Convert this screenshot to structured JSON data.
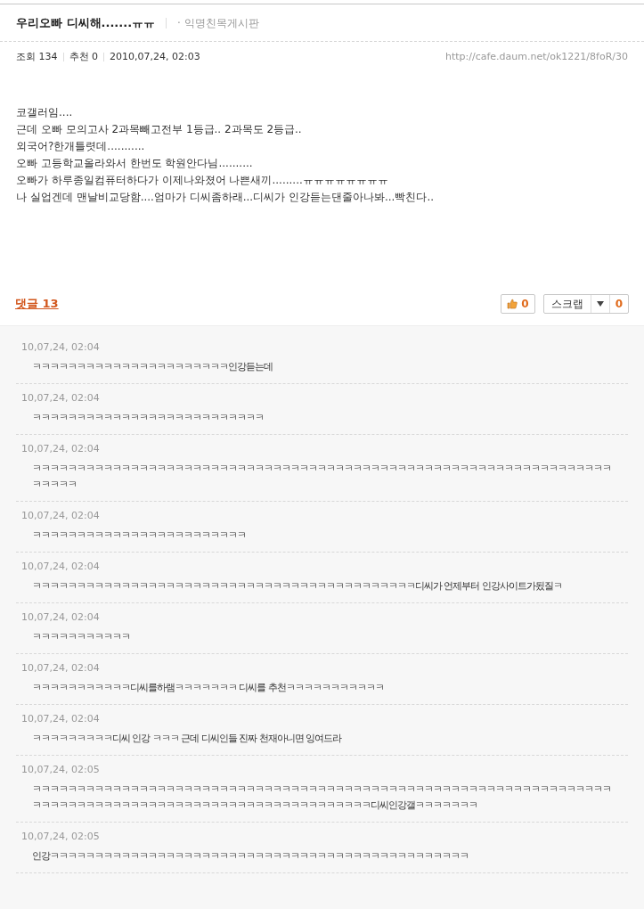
{
  "post": {
    "title": "우리오빠 디씨해.......ㅠㅠ",
    "board": "· 익명친목게시판",
    "meta": [
      "조회 134",
      "추천 0",
      "2010,07,24, 02:03"
    ],
    "url": "http://cafe.daum.net/ok1221/8foR/30",
    "body": [
      "코갤러임....",
      "근데 오빠 모의고사 2과목빼고전부 1등급.. 2과목도 2등급..",
      "외국어?한개틀렷데...........",
      "오빠 고등학교올라와서 한번도 학원안다님..........",
      "오빠가 하루종일컴퓨터하다가 이제나와졌어 나쁜새끼.........ㅠㅠㅠㅠㅠㅠㅠㅠ",
      "나 실업겐데 맨날비교당함....엄마가 디씨좀하래...디씨가 인강듣는댄줄아나봐...빡친다.."
    ]
  },
  "comments_header": {
    "label": "댓글 13",
    "like_count": "0",
    "scrap_label": "스크랩",
    "scrap_count": "0"
  },
  "comments": [
    {
      "time": "10,07,24, 02:04",
      "lines": [
        "ㅋㅋㅋㅋㅋㅋㅋㅋㅋㅋㅋㅋㅋㅋㅋㅋㅋㅋㅋㅋㅋㅋ인강듣는데"
      ]
    },
    {
      "time": "10,07,24, 02:04",
      "lines": [
        "ㅋㅋㅋㅋㅋㅋㅋㅋㅋㅋㅋㅋㅋㅋㅋㅋㅋㅋㅋㅋㅋㅋㅋㅋㅋㅋ"
      ]
    },
    {
      "time": "10,07,24, 02:04",
      "lines": [
        "ㅋㅋㅋㅋㅋㅋㅋㅋㅋㅋㅋㅋㅋㅋㅋㅋㅋㅋㅋㅋㅋㅋㅋㅋㅋㅋㅋㅋㅋㅋㅋㅋㅋㅋㅋㅋㅋㅋㅋㅋㅋㅋㅋㅋㅋㅋㅋㅋㅋㅋㅋㅋㅋㅋㅋㅋㅋㅋㅋㅋㅋㅋㅋㅋㅋ",
        "ㅋㅋㅋㅋㅋ"
      ]
    },
    {
      "time": "10,07,24, 02:04",
      "lines": [
        "ㅋㅋㅋㅋㅋㅋㅋㅋㅋㅋㅋㅋㅋㅋㅋㅋㅋㅋㅋㅋㅋㅋㅋㅋ"
      ]
    },
    {
      "time": "10,07,24, 02:04",
      "lines": [
        "ㅋㅋㅋㅋㅋㅋㅋㅋㅋㅋㅋㅋㅋㅋㅋㅋㅋㅋㅋㅋㅋㅋㅋㅋㅋㅋㅋㅋㅋㅋㅋㅋㅋㅋㅋㅋㅋㅋㅋㅋㅋㅋㅋ디씨가 언제부터 인강사이트가됬질ㅋ"
      ]
    },
    {
      "time": "10,07,24, 02:04",
      "lines": [
        "ㅋㅋㅋㅋㅋㅋㅋㅋㅋㅋㅋ"
      ]
    },
    {
      "time": "10,07,24, 02:04",
      "lines": [
        "ㅋㅋㅋㅋㅋㅋㅋㅋㅋㅋㅋ디씨를하램ㅋㅋㅋㅋㅋㅋㅋ 디씨를 추천ㅋㅋㅋㅋㅋㅋㅋㅋㅋㅋㅋ"
      ]
    },
    {
      "time": "10,07,24, 02:04",
      "lines": [
        "ㅋㅋㅋㅋㅋㅋㅋㅋㅋ디씨 인강 ㅋㅋㅋ 근데 디씨인들 진짜 천재아니면 잉여드라"
      ]
    },
    {
      "time": "10,07,24, 02:05",
      "lines": [
        "ㅋㅋㅋㅋㅋㅋㅋㅋㅋㅋㅋㅋㅋㅋㅋㅋㅋㅋㅋㅋㅋㅋㅋㅋㅋㅋㅋㅋㅋㅋㅋㅋㅋㅋㅋㅋㅋㅋㅋㅋㅋㅋㅋㅋㅋㅋㅋㅋㅋㅋㅋㅋㅋㅋㅋㅋㅋㅋㅋㅋㅋㅋㅋㅋㅋ",
        "ㅋㅋㅋㅋㅋㅋㅋㅋㅋㅋㅋㅋㅋㅋㅋㅋㅋㅋㅋㅋㅋㅋㅋㅋㅋㅋㅋㅋㅋㅋㅋㅋㅋㅋㅋㅋㅋㅋ디씨인강갤ㅋㅋㅋㅋㅋㅋㅋ"
      ]
    },
    {
      "time": "10,07,24, 02:05",
      "lines": [
        "인강ㅋㅋㅋㅋㅋㅋㅋㅋㅋㅋㅋㅋㅋㅋㅋㅋㅋㅋㅋㅋㅋㅋㅋㅋㅋㅋㅋㅋㅋㅋㅋㅋㅋㅋㅋㅋㅋㅋㅋㅋㅋㅋㅋㅋㅋㅋㅋ"
      ]
    }
  ]
}
